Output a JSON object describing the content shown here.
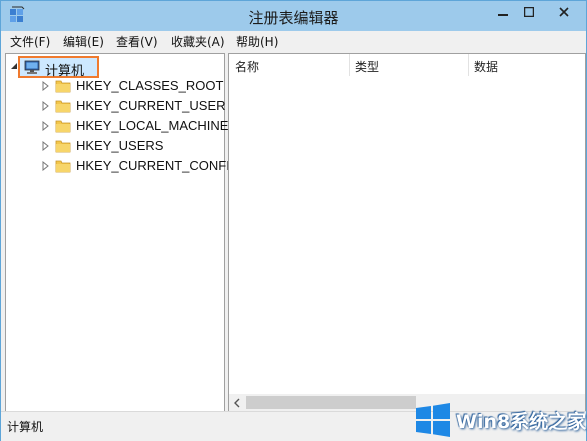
{
  "window": {
    "title": "注册表编辑器"
  },
  "menu": [
    {
      "label": "文件(F)"
    },
    {
      "label": "编辑(E)"
    },
    {
      "label": "查看(V)"
    },
    {
      "label": "收藏夹(A)"
    },
    {
      "label": "帮助(H)"
    }
  ],
  "tree": {
    "root_label": "计算机",
    "items": [
      {
        "label": "HKEY_CLASSES_ROOT"
      },
      {
        "label": "HKEY_CURRENT_USER"
      },
      {
        "label": "HKEY_LOCAL_MACHINE"
      },
      {
        "label": "HKEY_USERS"
      },
      {
        "label": "HKEY_CURRENT_CONFIG"
      }
    ]
  },
  "list": {
    "columns": [
      {
        "label": "名称"
      },
      {
        "label": "类型"
      },
      {
        "label": "数据"
      }
    ]
  },
  "status": {
    "path": "计算机"
  },
  "watermark": {
    "text": "Win8系统之家"
  },
  "colors": {
    "title_bar": "#9dcaeb",
    "highlight_border": "#f07a2e",
    "selection": "#cde8ff"
  }
}
